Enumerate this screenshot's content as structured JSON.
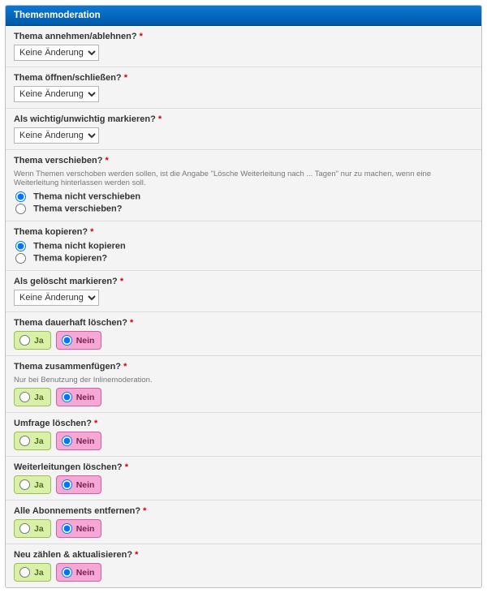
{
  "header": {
    "title": "Themenmoderation"
  },
  "common": {
    "select_default": "Keine Änderung",
    "yes": "Ja",
    "no": "Nein"
  },
  "rows": {
    "approve": {
      "label": "Thema annehmen/ablehnen?"
    },
    "openclose": {
      "label": "Thema öffnen/schließen?"
    },
    "important": {
      "label": "Als wichtig/unwichtig markieren?"
    },
    "move": {
      "label": "Thema verschieben?",
      "desc": "Wenn Themen verschoben werden sollen, ist die Angabe \"Lösche Weiterleitung nach ... Tagen\" nur zu machen, wenn eine Weiterleitung hinterlassen werden soll.",
      "opt1": "Thema nicht verschieben",
      "opt2": "Thema verschieben?",
      "selected": "opt1"
    },
    "copy": {
      "label": "Thema kopieren?",
      "opt1": "Thema nicht kopieren",
      "opt2": "Thema kopieren?",
      "selected": "opt1"
    },
    "deleted": {
      "label": "Als gelöscht markieren?"
    },
    "harddel": {
      "label": "Thema dauerhaft löschen?",
      "value": "no"
    },
    "merge": {
      "label": "Thema zusammenfügen?",
      "desc": "Nur bei Benutzung der Inlinemoderation.",
      "value": "no"
    },
    "polldel": {
      "label": "Umfrage löschen?",
      "value": "no"
    },
    "redirdel": {
      "label": "Weiterleitungen löschen?",
      "value": "no"
    },
    "subs": {
      "label": "Alle Abonnements entfernen?",
      "value": "no"
    },
    "recount": {
      "label": "Neu zählen & aktualisieren?",
      "value": "no"
    }
  }
}
